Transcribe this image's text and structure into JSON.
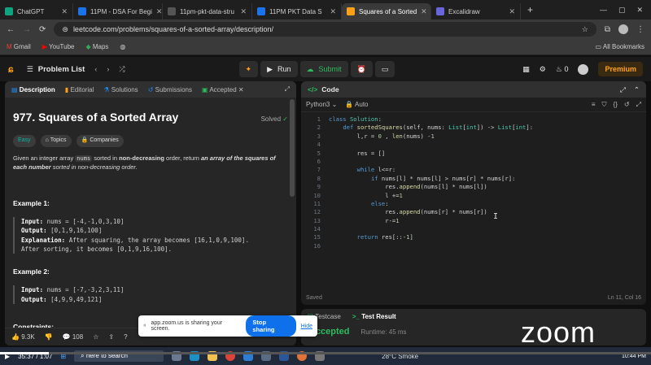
{
  "browser": {
    "tabs": [
      {
        "label": "ChatGPT",
        "color": "#10a37f"
      },
      {
        "label": "11PM - DSA For Begi",
        "color": "#1a73e8"
      },
      {
        "label": "11pm-pkt-data-stru",
        "color": "#555555"
      },
      {
        "label": "11PM PKT Data S",
        "color": "#1a73e8"
      },
      {
        "label": "Squares of a Sorted",
        "color": "#ffa116"
      },
      {
        "label": "Excalidraw",
        "color": "#6965db"
      }
    ],
    "url": "leetcode.com/problems/squares-of-a-sorted-array/description/",
    "bookmarks": [
      "Gmail",
      "YouTube",
      "Maps"
    ],
    "all_bookmarks": "All Bookmarks"
  },
  "lc_header": {
    "problem_list": "Problem List",
    "run": "Run",
    "submit": "Submit",
    "fire_count": "0",
    "premium": "Premium"
  },
  "left": {
    "tabs": [
      "Description",
      "Editorial",
      "Solutions",
      "Submissions",
      "Accepted"
    ],
    "title": "977. Squares of a Sorted Array",
    "solved": "Solved",
    "tags": [
      "Easy",
      "Topics",
      "Companies"
    ],
    "desc_parts": [
      "Given an integer array ",
      "nums",
      " sorted in ",
      "non-decreasing",
      " order, return ",
      "an array of the squares of each number",
      " sorted in non-decreasing order."
    ],
    "example1": {
      "heading": "Example 1:",
      "input": "nums = [-4,-1,0,3,10]",
      "output": "[0,1,9,16,100]",
      "explanation": "After squaring, the array becomes [16,1,0,9,100].",
      "explanation2": "After sorting, it becomes [0,1,9,16,100]."
    },
    "example2": {
      "heading": "Example 2:",
      "input": "nums = [-7,-3,2,3,11]",
      "output": "[4,9,9,49,121]"
    },
    "constraints": "Constraints:",
    "labels": {
      "input": "Input:",
      "output": "Output:",
      "explanation": "Explanation:"
    },
    "footer": {
      "likes": "9.3K",
      "comments": "108"
    }
  },
  "right": {
    "title": "Code",
    "lang": "Python3",
    "auto": "Auto",
    "saved": "Saved",
    "cursor": "Ln 11, Col 16",
    "code": [
      "class Solution:",
      "    def sortedSquares(self, nums: List[int]) -> List[int]:",
      "        l,r = 0 , len(nums) -1",
      "",
      "        res = []",
      "",
      "        while l<=r:",
      "            if nums[l] * nums[l] > nums[r] * nums[r]:",
      "                res.append(nums[l] * nums[l])",
      "                l +=1",
      "            else:",
      "                res.append(nums[r] * nums[r])",
      "                r-=1",
      "",
      "        return res[::-1]",
      ""
    ],
    "testcase": "Testcase",
    "test_result": "Test Result",
    "accepted": "Accepted",
    "runtime": "Runtime: 45 ms"
  },
  "overlay": {
    "sharing_text": "app.zoom.us is sharing your screen.",
    "stop_sharing": "Stop sharing",
    "hide": "Hide",
    "zoom_logo": "zoom"
  },
  "taskbar": {
    "time_played": "35:37 / 1:07",
    "search": "here to search",
    "weather": "28°C  Smoke",
    "clock": "10:44 PM"
  }
}
